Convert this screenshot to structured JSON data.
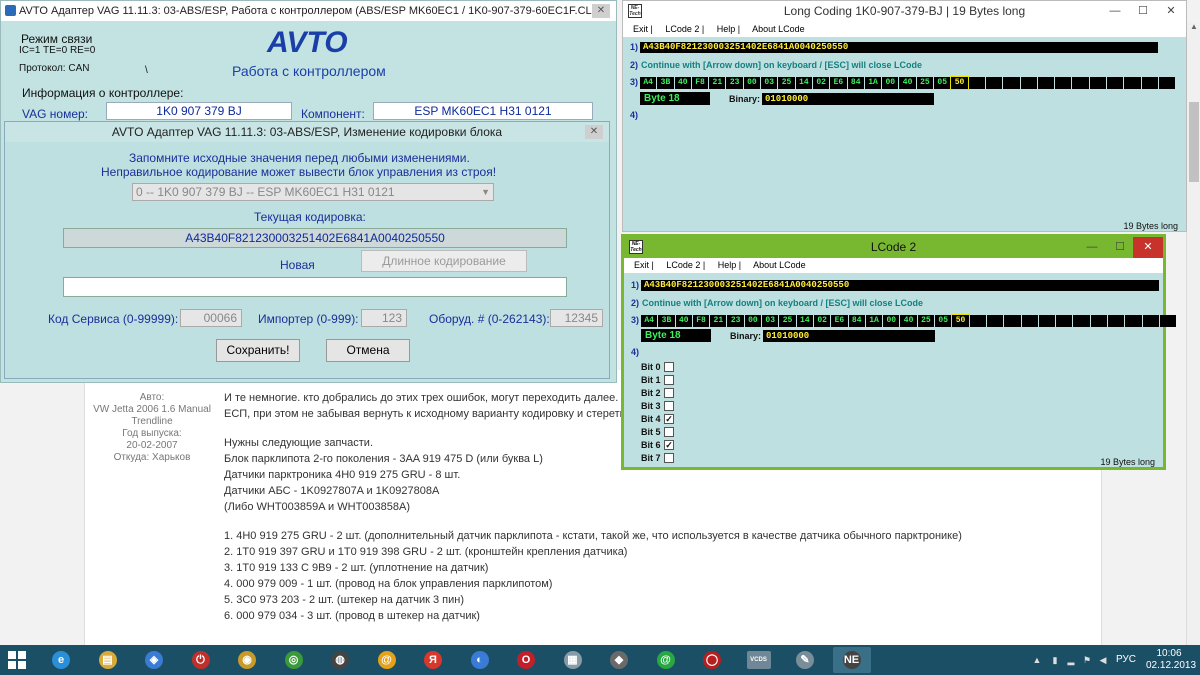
{
  "forum": {
    "meta_lines": [
      "Авто:",
      "VW Jetta 2006 1.6 Manual",
      "Trendline",
      "Год выпуска:",
      "20-02-2007",
      "Откуда: Харьков"
    ],
    "post_lines": [
      "И те немногие. кто добрались до этих трех ошибок, могут переходить далее. Ос",
      "ЕСП, при этом не забывая вернуть к исходному варианту кодировку и стереть в",
      "",
      "Нужны следующие запчасти.",
      "Блок парклипота 2-го поколения - 3AA 919 475 D (или буква L)",
      "Датчики парктроника 4H0 919 275 GRU - 8 шт.",
      "Датчики АБС - 1K0927807A и 1K0927808A",
      "(Либо WHT003859A и WHT003858A)",
      "",
      "1. 4H0 919 275 GRU - 2 шт. (дополнительный датчик парклипота - кстати, такой же, что используется в качестве датчика обычного парктронике)",
      "2. 1T0 919 397 GRU и 1T0 919 398 GRU - 2 шт. (кронштейн крепления датчика)",
      "3. 1T0 919 133 C 9B9 - 2 шт. (уплотнение на датчик)",
      "4. 000 979 009 - 1 шт. (провод на блок управления парклипотом)",
      "5. 3C0 973 203 - 2 шт. (штекер на датчик 3 пин)",
      "6. 000 979 034 - 3 шт. (провод в штекер на датчик)"
    ]
  },
  "avto_main": {
    "title": "AVTO Адаптер VAG 11.11.3: 03-ABS/ESP,  Работа с контроллером (ABS/ESP MK60EC1 / 1K0-907-379-60EC1F.CL...",
    "close": "✕",
    "mode_label": "Режим связи",
    "mode_values": "IC=1  TE=0   RE=0",
    "protocol": "Протокол: CAN",
    "slash": "\\",
    "logo": "AVTO",
    "subtitle": "Работа с контроллером",
    "info_label": "Информация о контроллере:",
    "vag_label": "VAG номер:",
    "vag_value": "1K0 907 379 BJ",
    "component_label": "Компонент:",
    "component_value": "ESP MK60EC1    H31 0121"
  },
  "coding_dialog": {
    "title": "AVTO Адаптер VAG 11.11.3: 03-ABS/ESP,  Изменение кодировки блока",
    "close": "✕",
    "warning1": "Запомните исходные значения перед любыми изменениями.",
    "warning2": "Неправильное кодирование может вывести блок управления из строя!",
    "select_value": "0 -- 1K0 907 379 BJ -- ESP MK60EC1    H31 0121",
    "current_label": "Текущая кодировка:",
    "current_value": "A43B40F821230003251402E6841A0040250550",
    "new_label": "Новая",
    "long_coding_btn": "Длинное кодирование",
    "service_label": "Код Сервиса (0-99999):",
    "service_value": "00066",
    "importer_label": "Импортер (0-999):",
    "importer_value": "123",
    "equipment_label": "Оборуд. # (0-262143):",
    "equipment_value": "12345",
    "save_btn": "Сохранить!",
    "cancel_btn": "Отмена"
  },
  "long_coding": {
    "title": "Long Coding   1K0-907-379-BJ | 19 Bytes long",
    "menu": [
      "Exit |",
      "LCode 2 |",
      "Help |",
      "About LCode"
    ],
    "row1_label": "1)",
    "code": "A43B40F821230003251402E6841A0040250550",
    "row2_label": "2)",
    "continue_text": "Continue with [Arrow down] on keyboard / [ESC] will close LCode",
    "row3_label": "3)",
    "bytes": [
      "A4",
      "3B",
      "40",
      "F8",
      "21",
      "23",
      "00",
      "03",
      "25",
      "14",
      "02",
      "E6",
      "84",
      "1A",
      "00",
      "40",
      "25",
      "05",
      "50",
      "",
      "",
      "",
      "",
      "",
      "",
      "",
      "",
      "",
      "",
      "",
      ""
    ],
    "selected_index": 18,
    "byte_label": "Byte 18",
    "binary_label": "Binary:",
    "binary_value": "01010000",
    "row4_label": "4)",
    "status": "19 Bytes long"
  },
  "lcode2": {
    "title": "LCode 2",
    "menu": [
      "Exit |",
      "LCode 2 |",
      "Help |",
      "About LCode"
    ],
    "row1_label": "1)",
    "code": "A43B40F821230003251402E6841A0040250550",
    "row2_label": "2)",
    "continue_text": "Continue with [Arrow down] on keyboard / [ESC] will close LCode",
    "row3_label": "3)",
    "byte_label": "Byte 18",
    "binary_label": "Binary:",
    "binary_value": "01010000",
    "row4_label": "4)",
    "bits": [
      {
        "label": "Bit 0",
        "checked": false
      },
      {
        "label": "Bit 1",
        "checked": false
      },
      {
        "label": "Bit 2",
        "checked": false
      },
      {
        "label": "Bit 3",
        "checked": false
      },
      {
        "label": "Bit 4",
        "checked": true
      },
      {
        "label": "Bit 5",
        "checked": false
      },
      {
        "label": "Bit 6",
        "checked": true
      },
      {
        "label": "Bit 7",
        "checked": false
      }
    ],
    "status": "19 Bytes long",
    "window_controls": [
      "—",
      "☐",
      "✕"
    ]
  },
  "taskbar": {
    "apps": [
      {
        "name": "internet-explorer",
        "glyph": "e",
        "color": "#2b8fd8"
      },
      {
        "name": "file-explorer",
        "glyph": "▤",
        "color": "#d9a93a"
      },
      {
        "name": "app-blue",
        "glyph": "◈",
        "color": "#3a7bd5"
      },
      {
        "name": "power-red",
        "glyph": "⏻",
        "color": "#c0302b"
      },
      {
        "name": "app-yellow",
        "glyph": "◉",
        "color": "#c79a2a"
      },
      {
        "name": "chrome",
        "glyph": "◎",
        "color": "#3a9a3a"
      },
      {
        "name": "speaker",
        "glyph": "◍",
        "color": "#444"
      },
      {
        "name": "mail-at",
        "glyph": "@",
        "color": "#e3a21a"
      },
      {
        "name": "yandex",
        "glyph": "Я",
        "color": "#d8382b"
      },
      {
        "name": "media",
        "glyph": "◐",
        "color": "#3a7bd5"
      },
      {
        "name": "opera",
        "glyph": "O",
        "color": "#c0202b"
      },
      {
        "name": "calculator",
        "glyph": "▦",
        "color": "#8a9ba8"
      },
      {
        "name": "tank-game",
        "glyph": "◆",
        "color": "#6a6a6a"
      },
      {
        "name": "mail-ru",
        "glyph": "@",
        "color": "#27a843"
      },
      {
        "name": "acrobat",
        "glyph": "◯",
        "color": "#b51f1f"
      },
      {
        "name": "vcds",
        "glyph": "VCDS",
        "color": "#6f8796"
      },
      {
        "name": "paint",
        "glyph": "✎",
        "color": "#7a8e9a"
      },
      {
        "name": "netech",
        "glyph": "NE",
        "color": "#444"
      }
    ],
    "lang": "РУС",
    "time": "10:06",
    "date": "02.12.2013"
  }
}
